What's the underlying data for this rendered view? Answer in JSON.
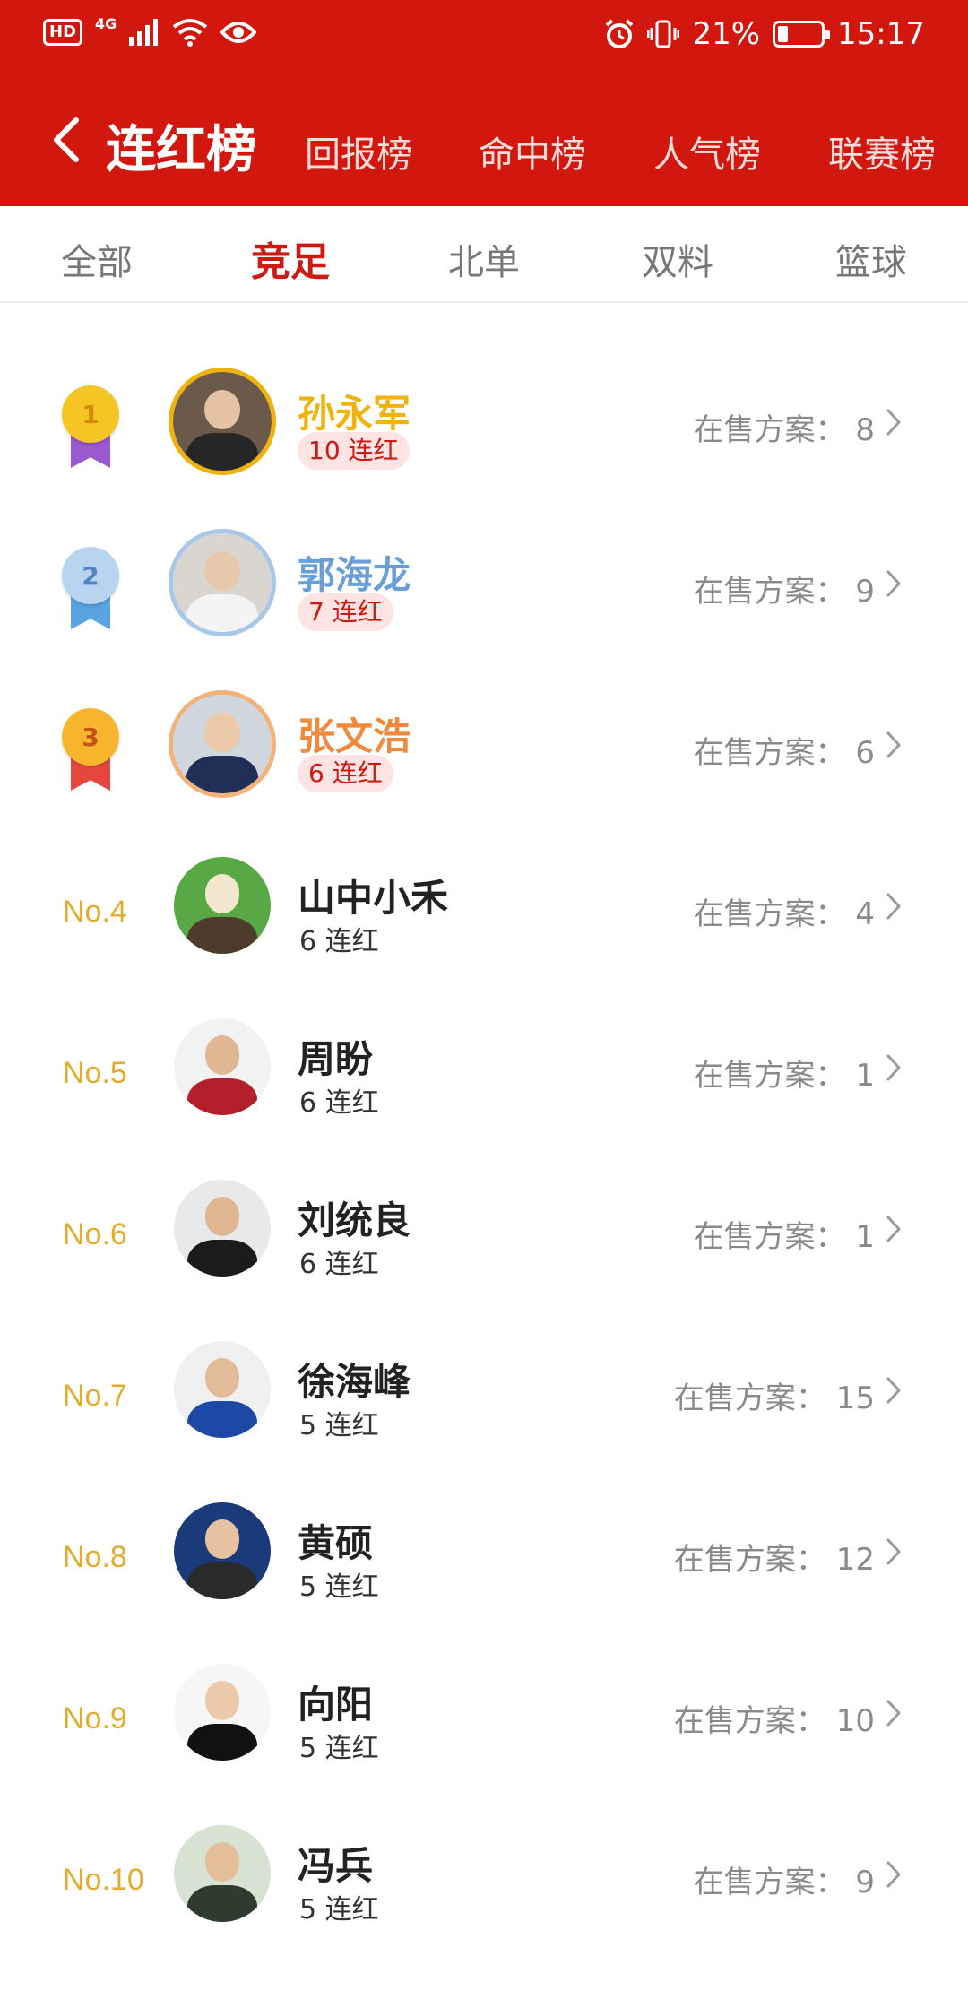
{
  "status_bar": {
    "left": {
      "hd": "HD",
      "signal": "4G"
    },
    "battery": "21%",
    "battery_level": 0.21,
    "time": "15:17"
  },
  "header": {
    "title": "连红榜",
    "tabs": [
      "回报榜",
      "命中榜",
      "人气榜",
      "联赛榜"
    ]
  },
  "sub_tabs": {
    "items": [
      "全部",
      "竞足",
      "北单",
      "双料",
      "篮球"
    ],
    "active": "竞足"
  },
  "colors": {
    "header_red": "#d2170f",
    "gold": "#f0b30e",
    "silver_blue": "#6a9fd6",
    "bronze_orange": "#ef8a3d",
    "rank_text": "#e1ad2f"
  },
  "sale_label": "在售方案：",
  "rankings": [
    {
      "rank": "1",
      "name": "孙永军",
      "streak": "10 连红",
      "on_sale": "8"
    },
    {
      "rank": "2",
      "name": "郭海龙",
      "streak": "7 连红",
      "on_sale": "9"
    },
    {
      "rank": "3",
      "name": "张文浩",
      "streak": "6 连红",
      "on_sale": "6"
    },
    {
      "rank": "No.4",
      "name": "山中小禾",
      "streak": "6 连红",
      "on_sale": "4"
    },
    {
      "rank": "No.5",
      "name": "周盼",
      "streak": "6 连红",
      "on_sale": "1"
    },
    {
      "rank": "No.6",
      "name": "刘统良",
      "streak": "6 连红",
      "on_sale": "1"
    },
    {
      "rank": "No.7",
      "name": "徐海峰",
      "streak": "5 连红",
      "on_sale": "15"
    },
    {
      "rank": "No.8",
      "name": "黄硕",
      "streak": "5 连红",
      "on_sale": "12"
    },
    {
      "rank": "No.9",
      "name": "向阳",
      "streak": "5 连红",
      "on_sale": "10"
    },
    {
      "rank": "No.10",
      "name": "冯兵",
      "streak": "5 连红",
      "on_sale": "9"
    }
  ]
}
